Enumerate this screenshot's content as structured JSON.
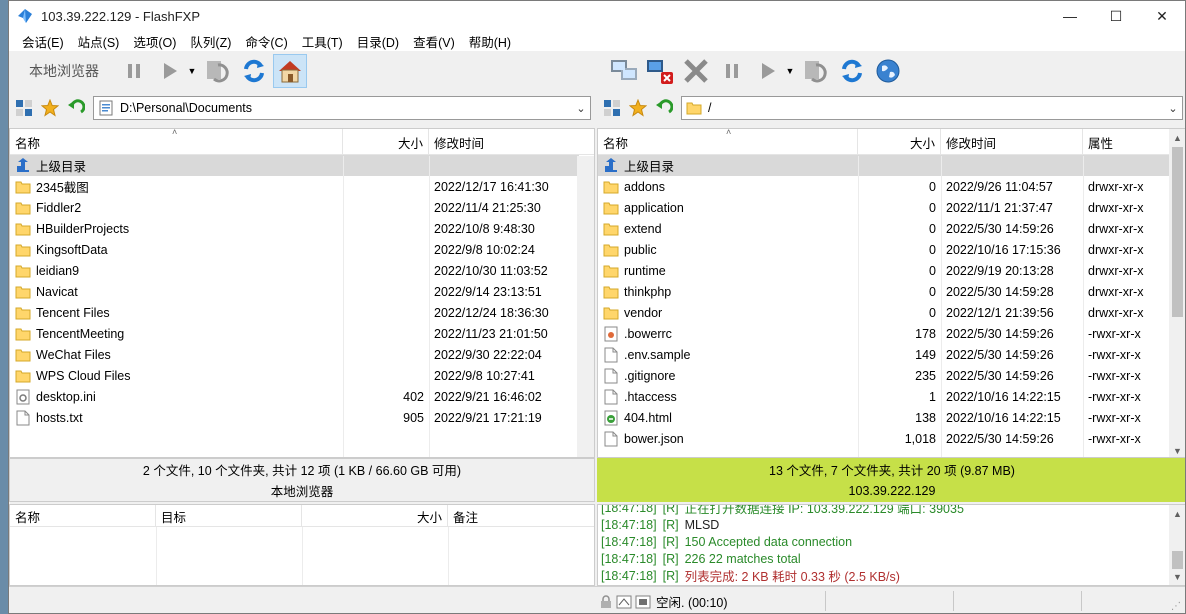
{
  "window": {
    "title": "103.39.222.129 - FlashFXP"
  },
  "menu": [
    "会话(E)",
    "站点(S)",
    "选项(O)",
    "队列(Z)",
    "命令(C)",
    "工具(T)",
    "目录(D)",
    "查看(V)",
    "帮助(H)"
  ],
  "left_toolbar": {
    "label": "本地浏览器"
  },
  "left_address": {
    "path": "D:\\Personal\\Documents"
  },
  "right_address": {
    "path": "/"
  },
  "left_headers": {
    "name": "名称",
    "size": "大小",
    "modified": "修改时间"
  },
  "right_headers": {
    "name": "名称",
    "size": "大小",
    "modified": "修改时间",
    "attr": "属性"
  },
  "parent_label": "上级目录",
  "left_files": [
    {
      "name": "2345截图",
      "size": "",
      "modified": "2022/12/17 16:41:30",
      "type": "folder"
    },
    {
      "name": "Fiddler2",
      "size": "",
      "modified": "2022/11/4 21:25:30",
      "type": "folder"
    },
    {
      "name": "HBuilderProjects",
      "size": "",
      "modified": "2022/10/8 9:48:30",
      "type": "folder"
    },
    {
      "name": "KingsoftData",
      "size": "",
      "modified": "2022/9/8 10:02:24",
      "type": "folder"
    },
    {
      "name": "leidian9",
      "size": "",
      "modified": "2022/10/30 11:03:52",
      "type": "folder"
    },
    {
      "name": "Navicat",
      "size": "",
      "modified": "2022/9/14 23:13:51",
      "type": "folder"
    },
    {
      "name": "Tencent Files",
      "size": "",
      "modified": "2022/12/24 18:36:30",
      "type": "folder"
    },
    {
      "name": "TencentMeeting",
      "size": "",
      "modified": "2022/11/23 21:01:50",
      "type": "folder"
    },
    {
      "name": "WeChat Files",
      "size": "",
      "modified": "2022/9/30 22:22:04",
      "type": "folder"
    },
    {
      "name": "WPS Cloud Files",
      "size": "",
      "modified": "2022/9/8 10:27:41",
      "type": "folder"
    },
    {
      "name": "desktop.ini",
      "size": "402",
      "modified": "2022/9/21 16:46:02",
      "type": "ini"
    },
    {
      "name": "hosts.txt",
      "size": "905",
      "modified": "2022/9/21 17:21:19",
      "type": "txt"
    }
  ],
  "right_files": [
    {
      "name": "addons",
      "size": "0",
      "modified": "2022/9/26 11:04:57",
      "attr": "drwxr-xr-x",
      "type": "folder"
    },
    {
      "name": "application",
      "size": "0",
      "modified": "2022/11/1 21:37:47",
      "attr": "drwxr-xr-x",
      "type": "folder"
    },
    {
      "name": "extend",
      "size": "0",
      "modified": "2022/5/30 14:59:26",
      "attr": "drwxr-xr-x",
      "type": "folder"
    },
    {
      "name": "public",
      "size": "0",
      "modified": "2022/10/16 17:15:36",
      "attr": "drwxr-xr-x",
      "type": "folder"
    },
    {
      "name": "runtime",
      "size": "0",
      "modified": "2022/9/19 20:13:28",
      "attr": "drwxr-xr-x",
      "type": "folder"
    },
    {
      "name": "thinkphp",
      "size": "0",
      "modified": "2022/5/30 14:59:28",
      "attr": "drwxr-xr-x",
      "type": "folder"
    },
    {
      "name": "vendor",
      "size": "0",
      "modified": "2022/12/1 21:39:56",
      "attr": "drwxr-xr-x",
      "type": "folder"
    },
    {
      "name": ".bowerrc",
      "size": "178",
      "modified": "2022/5/30 14:59:26",
      "attr": "-rwxr-xr-x",
      "type": "rc"
    },
    {
      "name": ".env.sample",
      "size": "149",
      "modified": "2022/5/30 14:59:26",
      "attr": "-rwxr-xr-x",
      "type": "txt"
    },
    {
      "name": ".gitignore",
      "size": "235",
      "modified": "2022/5/30 14:59:26",
      "attr": "-rwxr-xr-x",
      "type": "txt"
    },
    {
      "name": ".htaccess",
      "size": "1",
      "modified": "2022/10/16 14:22:15",
      "attr": "-rwxr-xr-x",
      "type": "txt"
    },
    {
      "name": "404.html",
      "size": "138",
      "modified": "2022/10/16 14:22:15",
      "attr": "-rwxr-xr-x",
      "type": "html"
    },
    {
      "name": "bower.json",
      "size": "1,018",
      "modified": "2022/5/30 14:59:26",
      "attr": "-rwxr-xr-x",
      "type": "txt"
    }
  ],
  "left_status": {
    "summary": "2 个文件, 10 个文件夹, 共计 12 项 (1 KB / 66.60 GB 可用)",
    "label": "本地浏览器"
  },
  "right_status": {
    "summary": "13 个文件, 7 个文件夹, 共计 20 项 (9.87 MB)",
    "label": "103.39.222.129"
  },
  "queue_headers": {
    "name": "名称",
    "target": "目标",
    "size": "大小",
    "note": "备注"
  },
  "log": [
    {
      "ts": "[18:47:18]",
      "tag": "[R]",
      "msg": "正在打开数据连接 IP: 103.39.222.129 端口: 39035",
      "color": "#2a8a2a"
    },
    {
      "ts": "[18:47:18]",
      "tag": "[R]",
      "msg": "MLSD",
      "color": "#222222"
    },
    {
      "ts": "[18:47:18]",
      "tag": "[R]",
      "msg": "150 Accepted data connection",
      "color": "#2a8a2a"
    },
    {
      "ts": "[18:47:18]",
      "tag": "[R]",
      "msg": "226 22 matches total",
      "color": "#2a8a2a"
    },
    {
      "ts": "[18:47:18]",
      "tag": "[R]",
      "msg": "列表完成: 2 KB 耗时 0.33 秒 (2.5 KB/s)",
      "color": "#b03030"
    }
  ],
  "bottom_status": {
    "text": "空闲. (00:10)"
  },
  "colors": {
    "selected_row": "#d9d9d9",
    "remote_status": "#c6e048",
    "log_green": "#2a8a2a",
    "log_red": "#b03030"
  }
}
